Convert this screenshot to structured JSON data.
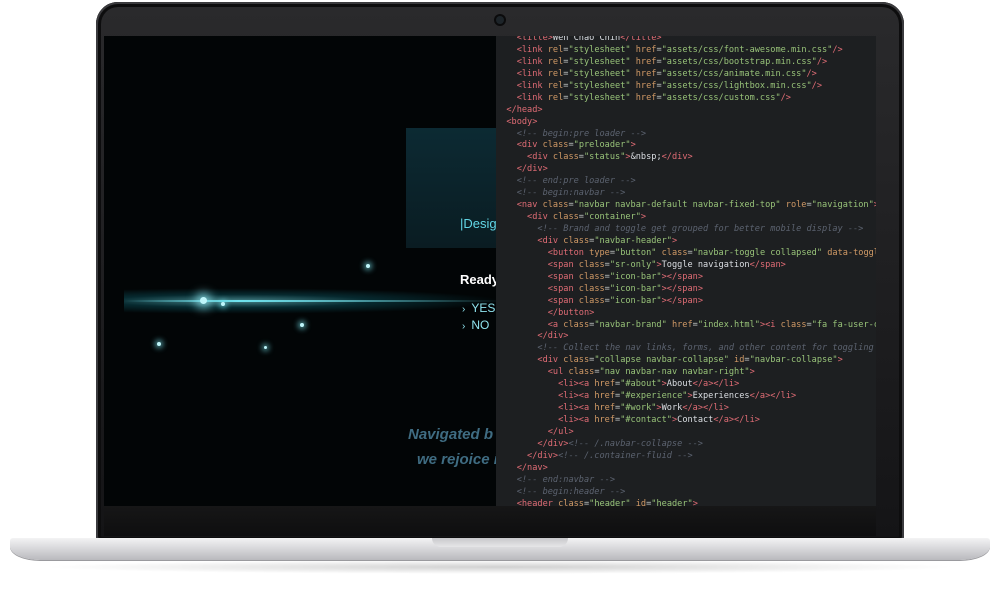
{
  "website": {
    "hero_text": "|Desig",
    "prompt": "Ready",
    "options": [
      "YES",
      "NO"
    ],
    "tagline_1": "Navigated b",
    "tagline_2": "we rejoice i"
  },
  "editor": {
    "lines": [
      {
        "indent": 1,
        "tokens": [
          [
            "tag",
            "<title>"
          ],
          [
            "txt",
            "Wen Chao Chin"
          ],
          [
            "tag",
            "</title>"
          ]
        ]
      },
      {
        "indent": 1,
        "tokens": [
          [
            "tag",
            "<link "
          ],
          [
            "attr",
            "rel"
          ],
          [
            "eq",
            "="
          ],
          [
            "str",
            "\"stylesheet\""
          ],
          [
            "attr",
            " href"
          ],
          [
            "eq",
            "="
          ],
          [
            "str",
            "\"assets/css/font-awesome.min.css\""
          ],
          [
            "tag",
            "/>"
          ]
        ]
      },
      {
        "indent": 1,
        "tokens": [
          [
            "tag",
            "<link "
          ],
          [
            "attr",
            "rel"
          ],
          [
            "eq",
            "="
          ],
          [
            "str",
            "\"stylesheet\""
          ],
          [
            "attr",
            " href"
          ],
          [
            "eq",
            "="
          ],
          [
            "str",
            "\"assets/css/bootstrap.min.css\""
          ],
          [
            "tag",
            "/>"
          ]
        ]
      },
      {
        "indent": 1,
        "tokens": [
          [
            "tag",
            "<link "
          ],
          [
            "attr",
            "rel"
          ],
          [
            "eq",
            "="
          ],
          [
            "str",
            "\"stylesheet\""
          ],
          [
            "attr",
            " href"
          ],
          [
            "eq",
            "="
          ],
          [
            "str",
            "\"assets/css/animate.min.css\""
          ],
          [
            "tag",
            "/>"
          ]
        ]
      },
      {
        "indent": 1,
        "tokens": [
          [
            "tag",
            "<link "
          ],
          [
            "attr",
            "rel"
          ],
          [
            "eq",
            "="
          ],
          [
            "str",
            "\"stylesheet\""
          ],
          [
            "attr",
            " href"
          ],
          [
            "eq",
            "="
          ],
          [
            "str",
            "\"assets/css/lightbox.min.css\""
          ],
          [
            "tag",
            "/>"
          ]
        ]
      },
      {
        "indent": 1,
        "tokens": [
          [
            "tag",
            "<link "
          ],
          [
            "attr",
            "rel"
          ],
          [
            "eq",
            "="
          ],
          [
            "str",
            "\"stylesheet\""
          ],
          [
            "attr",
            " href"
          ],
          [
            "eq",
            "="
          ],
          [
            "str",
            "\"assets/css/custom.css\""
          ],
          [
            "tag",
            "/>"
          ]
        ]
      },
      {
        "indent": 0,
        "tokens": [
          [
            "tag",
            "</head>"
          ]
        ]
      },
      {
        "indent": 0,
        "tokens": [
          [
            "tag",
            "<body>"
          ]
        ]
      },
      {
        "indent": 1,
        "tokens": [
          [
            "cmt",
            "<!-- begin:pre loader -->"
          ]
        ]
      },
      {
        "indent": 1,
        "tokens": [
          [
            "tag",
            "<div "
          ],
          [
            "attr",
            "class"
          ],
          [
            "eq",
            "="
          ],
          [
            "str",
            "\"preloader\""
          ],
          [
            "tag",
            ">"
          ]
        ]
      },
      {
        "indent": 2,
        "tokens": [
          [
            "tag",
            "<div "
          ],
          [
            "attr",
            "class"
          ],
          [
            "eq",
            "="
          ],
          [
            "str",
            "\"status\""
          ],
          [
            "tag",
            ">"
          ],
          [
            "txt",
            "&nbsp;"
          ],
          [
            "tag",
            "</div>"
          ]
        ]
      },
      {
        "indent": 1,
        "tokens": [
          [
            "tag",
            "</div>"
          ]
        ]
      },
      {
        "indent": 1,
        "tokens": [
          [
            "cmt",
            "<!-- end:pre loader -->"
          ]
        ]
      },
      {
        "indent": 1,
        "tokens": [
          [
            "cmt",
            "<!-- begin:navbar -->"
          ]
        ]
      },
      {
        "indent": 1,
        "tokens": [
          [
            "tag",
            "<nav "
          ],
          [
            "attr",
            "class"
          ],
          [
            "eq",
            "="
          ],
          [
            "str",
            "\"navbar navbar-default navbar-fixed-top\""
          ],
          [
            "attr",
            " role"
          ],
          [
            "eq",
            "="
          ],
          [
            "str",
            "\"navigation\""
          ],
          [
            "tag",
            ">"
          ]
        ]
      },
      {
        "indent": 2,
        "tokens": [
          [
            "tag",
            "<div "
          ],
          [
            "attr",
            "class"
          ],
          [
            "eq",
            "="
          ],
          [
            "str",
            "\"container\""
          ],
          [
            "tag",
            ">"
          ]
        ]
      },
      {
        "indent": 3,
        "tokens": [
          [
            "cmt",
            "<!-- Brand and toggle get grouped for better mobile display -->"
          ]
        ]
      },
      {
        "indent": 3,
        "tokens": [
          [
            "tag",
            "<div "
          ],
          [
            "attr",
            "class"
          ],
          [
            "eq",
            "="
          ],
          [
            "str",
            "\"navbar-header\""
          ],
          [
            "tag",
            ">"
          ]
        ]
      },
      {
        "indent": 4,
        "tokens": [
          [
            "tag",
            "<button "
          ],
          [
            "attr",
            "type"
          ],
          [
            "eq",
            "="
          ],
          [
            "str",
            "\"button\""
          ],
          [
            "attr",
            " class"
          ],
          [
            "eq",
            "="
          ],
          [
            "str",
            "\"navbar-toggle collapsed\""
          ],
          [
            "attr",
            " data-toggle"
          ],
          [
            "eq",
            "="
          ],
          [
            "str",
            "\"coll"
          ]
        ]
      },
      {
        "indent": 4,
        "tokens": [
          [
            "tag",
            "<span "
          ],
          [
            "attr",
            "class"
          ],
          [
            "eq",
            "="
          ],
          [
            "str",
            "\"sr-only\""
          ],
          [
            "tag",
            ">"
          ],
          [
            "txt",
            "Toggle navigation"
          ],
          [
            "tag",
            "</span>"
          ]
        ]
      },
      {
        "indent": 4,
        "tokens": [
          [
            "tag",
            "<span "
          ],
          [
            "attr",
            "class"
          ],
          [
            "eq",
            "="
          ],
          [
            "str",
            "\"icon-bar\""
          ],
          [
            "tag",
            "></span>"
          ]
        ]
      },
      {
        "indent": 4,
        "tokens": [
          [
            "tag",
            "<span "
          ],
          [
            "attr",
            "class"
          ],
          [
            "eq",
            "="
          ],
          [
            "str",
            "\"icon-bar\""
          ],
          [
            "tag",
            "></span>"
          ]
        ]
      },
      {
        "indent": 4,
        "tokens": [
          [
            "tag",
            "<span "
          ],
          [
            "attr",
            "class"
          ],
          [
            "eq",
            "="
          ],
          [
            "str",
            "\"icon-bar\""
          ],
          [
            "tag",
            "></span>"
          ]
        ]
      },
      {
        "indent": 4,
        "tokens": [
          [
            "tag",
            "</button>"
          ]
        ]
      },
      {
        "indent": 4,
        "tokens": [
          [
            "tag",
            "<a "
          ],
          [
            "attr",
            "class"
          ],
          [
            "eq",
            "="
          ],
          [
            "str",
            "\"navbar-brand\""
          ],
          [
            "attr",
            " href"
          ],
          [
            "eq",
            "="
          ],
          [
            "str",
            "\"index.html\""
          ],
          [
            "tag",
            "><i "
          ],
          [
            "attr",
            "class"
          ],
          [
            "eq",
            "="
          ],
          [
            "str",
            "\"fa fa-user-circle\""
          ],
          [
            "tag",
            ">"
          ]
        ]
      },
      {
        "indent": 3,
        "tokens": [
          [
            "tag",
            "</div>"
          ]
        ]
      },
      {
        "indent": 3,
        "tokens": [
          [
            "cmt",
            "<!-- Collect the nav links, forms, and other content for toggling -->"
          ]
        ]
      },
      {
        "indent": 3,
        "tokens": [
          [
            "tag",
            "<div "
          ],
          [
            "attr",
            "class"
          ],
          [
            "eq",
            "="
          ],
          [
            "str",
            "\"collapse navbar-collapse\""
          ],
          [
            "attr",
            " id"
          ],
          [
            "eq",
            "="
          ],
          [
            "str",
            "\"navbar-collapse\""
          ],
          [
            "tag",
            ">"
          ]
        ]
      },
      {
        "indent": 4,
        "tokens": [
          [
            "tag",
            "<ul "
          ],
          [
            "attr",
            "class"
          ],
          [
            "eq",
            "="
          ],
          [
            "str",
            "\"nav navbar-nav navbar-right\""
          ],
          [
            "tag",
            ">"
          ]
        ]
      },
      {
        "indent": 5,
        "tokens": [
          [
            "tag",
            "<li><a "
          ],
          [
            "attr",
            "href"
          ],
          [
            "eq",
            "="
          ],
          [
            "str",
            "\"#about\""
          ],
          [
            "tag",
            ">"
          ],
          [
            "txt",
            "About"
          ],
          [
            "tag",
            "</a></li>"
          ]
        ]
      },
      {
        "indent": 5,
        "tokens": [
          [
            "tag",
            "<li><a "
          ],
          [
            "attr",
            "href"
          ],
          [
            "eq",
            "="
          ],
          [
            "str",
            "\"#experience\""
          ],
          [
            "tag",
            ">"
          ],
          [
            "txt",
            "Experiences"
          ],
          [
            "tag",
            "</a></li>"
          ]
        ]
      },
      {
        "indent": 5,
        "tokens": [
          [
            "tag",
            "<li><a "
          ],
          [
            "attr",
            "href"
          ],
          [
            "eq",
            "="
          ],
          [
            "str",
            "\"#work\""
          ],
          [
            "tag",
            ">"
          ],
          [
            "txt",
            "Work"
          ],
          [
            "tag",
            "</a></li>"
          ]
        ]
      },
      {
        "indent": 5,
        "tokens": [
          [
            "tag",
            "<li><a "
          ],
          [
            "attr",
            "href"
          ],
          [
            "eq",
            "="
          ],
          [
            "str",
            "\"#contact\""
          ],
          [
            "tag",
            ">"
          ],
          [
            "txt",
            "Contact"
          ],
          [
            "tag",
            "</a></li>"
          ]
        ]
      },
      {
        "indent": 4,
        "tokens": [
          [
            "tag",
            "</ul>"
          ]
        ]
      },
      {
        "indent": 3,
        "tokens": [
          [
            "tag",
            "</div>"
          ],
          [
            "cmt",
            "<!-- /.navbar-collapse -->"
          ]
        ]
      },
      {
        "indent": 2,
        "tokens": [
          [
            "tag",
            "</div>"
          ],
          [
            "cmt",
            "<!-- /.container-fluid -->"
          ]
        ]
      },
      {
        "indent": 1,
        "tokens": [
          [
            "tag",
            "</nav>"
          ]
        ]
      },
      {
        "indent": 1,
        "tokens": [
          [
            "cmt",
            "<!-- end:navbar -->"
          ]
        ]
      },
      {
        "indent": 1,
        "tokens": [
          [
            "cmt",
            "<!-- begin:header -->"
          ]
        ]
      },
      {
        "indent": 1,
        "tokens": [
          [
            "tag",
            "<header "
          ],
          [
            "attr",
            "class"
          ],
          [
            "eq",
            "="
          ],
          [
            "str",
            "\"header\""
          ],
          [
            "attr",
            " id"
          ],
          [
            "eq",
            "="
          ],
          [
            "str",
            "\"header\""
          ],
          [
            "tag",
            ">"
          ]
        ]
      }
    ]
  },
  "colors": {
    "editor_bg": "#1d1f21",
    "tag": "#e06c75",
    "attr": "#d19a66",
    "string": "#98c379",
    "comment": "#5c6370",
    "accent": "#62d6e6"
  }
}
